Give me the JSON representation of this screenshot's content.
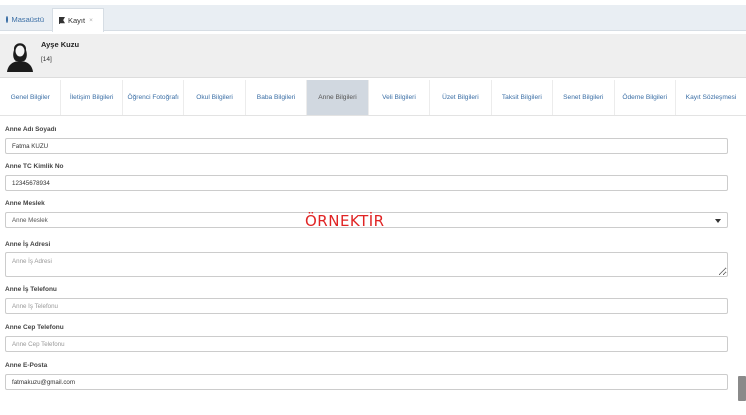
{
  "top_tabs": {
    "dashboard": "Masaüstü",
    "kayit": "Kayıt",
    "close": "×"
  },
  "profile": {
    "name": "Ayşe Kuzu",
    "number": "[14]"
  },
  "sub_tabs": [
    {
      "label": "Genel Bilgiler",
      "active": false
    },
    {
      "label": "İletişim Bilgileri",
      "active": false
    },
    {
      "label": "Öğrenci Fotoğrafı",
      "active": false
    },
    {
      "label": "Okul Bilgileri",
      "active": false
    },
    {
      "label": "Baba Bilgileri",
      "active": false
    },
    {
      "label": "Anne Bilgileri",
      "active": true
    },
    {
      "label": "Veli Bilgileri",
      "active": false
    },
    {
      "label": "Üzet Bilgileri",
      "active": false
    },
    {
      "label": "Taksit Bilgileri",
      "active": false
    },
    {
      "label": "Senet Bilgileri",
      "active": false
    },
    {
      "label": "Ödeme Bilgileri",
      "active": false
    },
    {
      "label": "Kayıt Sözleşmesi",
      "active": false
    }
  ],
  "form": {
    "ad_soyad": {
      "label": "Anne Adı Soyadı",
      "value": "Fatma KUZU"
    },
    "tc": {
      "label": "Anne TC Kimlik No",
      "value": "12345678934"
    },
    "meslek": {
      "label": "Anne Meslek",
      "value": "Anne Meslek"
    },
    "is_adresi": {
      "label": "Anne İş Adresi",
      "placeholder": "Anne İş Adresi"
    },
    "is_telefon": {
      "label": "Anne İş Telefonu",
      "placeholder": "Anne İş Telefonu"
    },
    "cep_telefon": {
      "label": "Anne Cep Telefonu",
      "placeholder": "Anne Cep Telefonu"
    },
    "eposta": {
      "label": "Anne E-Posta",
      "value": "fatmakuzu@gmail.com"
    }
  },
  "watermark": "ÖRNEKTİR",
  "colors": {
    "link": "#3a6ea5",
    "active_tab_bg": "#d1d8e0",
    "watermark": "#e02424"
  }
}
